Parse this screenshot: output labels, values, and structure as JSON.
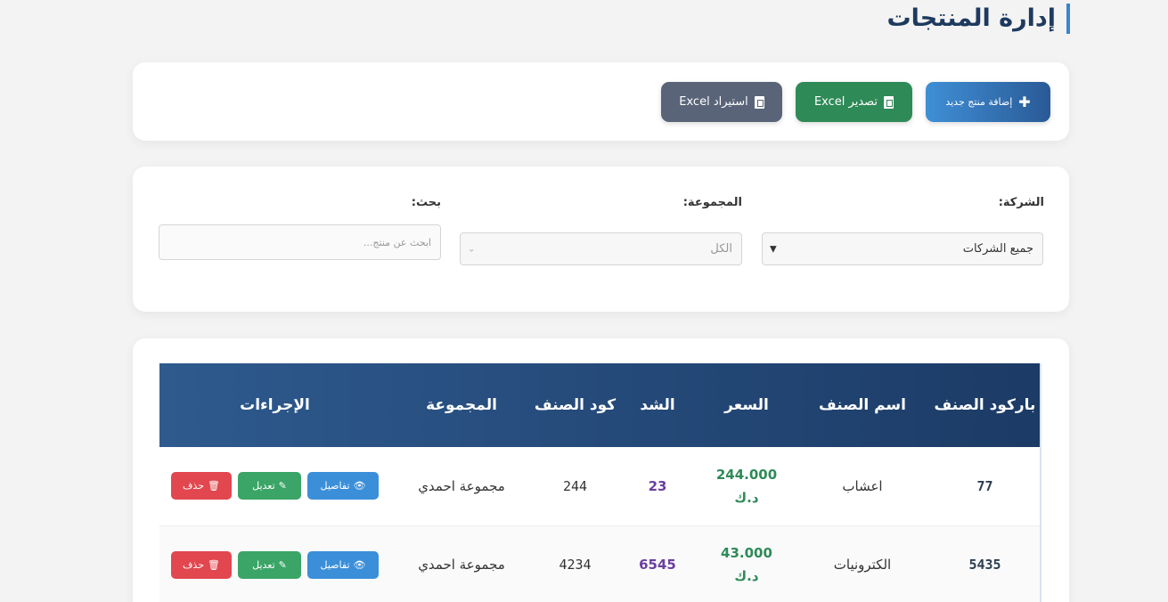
{
  "page": {
    "title": "إدارة المنتجات"
  },
  "actions": {
    "add_label": "إضافة منتج جديد",
    "export_label": "تصدير Excel",
    "import_label": "استيراد Excel"
  },
  "filters": {
    "company_label": "الشركة:",
    "company_value": "جميع الشركات",
    "group_label": "المجموعة:",
    "group_value": "الكل",
    "search_label": "بحث:",
    "search_placeholder": "ابحث عن منتج..."
  },
  "table": {
    "headers": {
      "barcode": "باركود الصنف",
      "name": "اسم الصنف",
      "price": "السعر",
      "pack": "الشد",
      "code": "كود الصنف",
      "group": "المجموعة",
      "actions": "الإجراءات"
    },
    "rows": [
      {
        "barcode": "77",
        "name": "اعشاب",
        "price": "244.000",
        "currency": "د.ك",
        "pack": "23",
        "code": "244",
        "group": "مجموعة احمدي"
      },
      {
        "barcode": "5435",
        "name": "الكترونيات",
        "price": "43.000",
        "currency": "د.ك",
        "pack": "6545",
        "code": "4234",
        "group": "مجموعة احمدي"
      }
    ],
    "row_actions": {
      "view": "تفاصيل",
      "edit": "تعديل",
      "delete": "حذف"
    }
  },
  "colors": {
    "primary": "#2a5a96",
    "success": "#2e8a57",
    "danger": "#e2474f",
    "info": "#3b8fd9"
  }
}
